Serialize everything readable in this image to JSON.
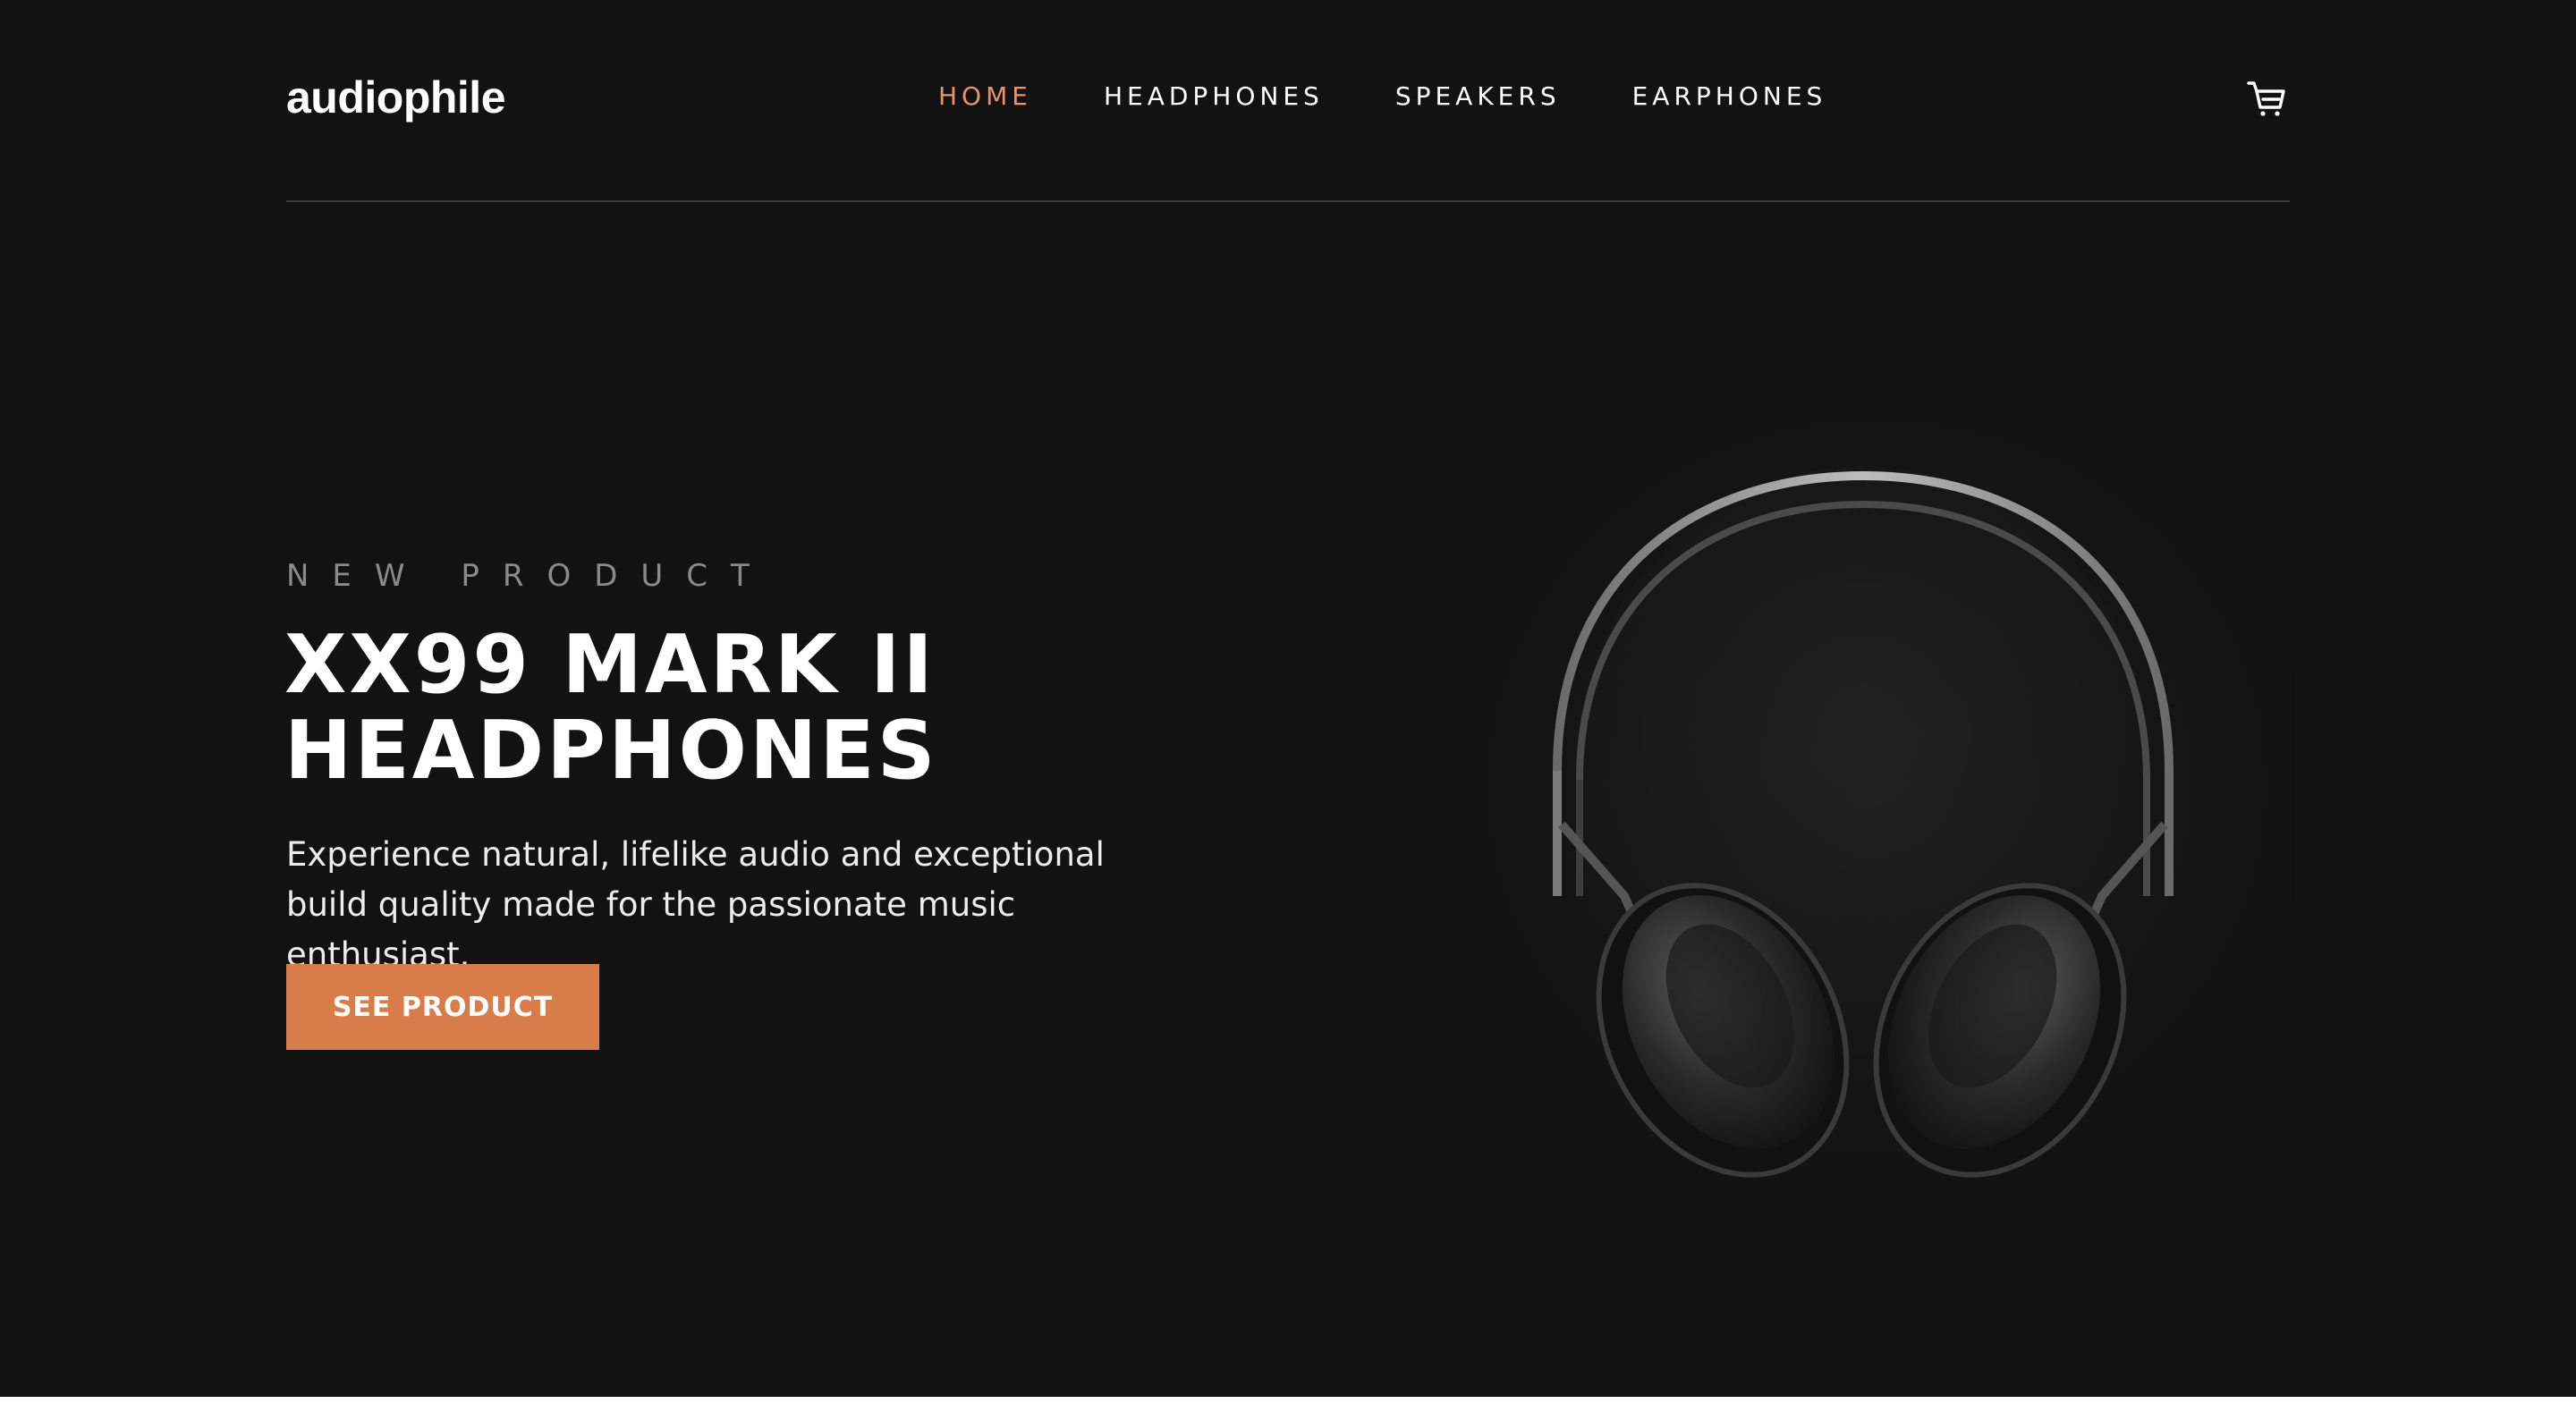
{
  "header": {
    "logo": "audiophile",
    "nav": [
      {
        "label": "HOME",
        "active": true
      },
      {
        "label": "HEADPHONES",
        "active": false
      },
      {
        "label": "SPEAKERS",
        "active": false
      },
      {
        "label": "EARPHONES",
        "active": false
      }
    ],
    "cart_icon": "cart-icon"
  },
  "hero": {
    "overline": "NEW PRODUCT",
    "title_line1": "XX99 MARK II",
    "title_line2": "HEADPHONES",
    "description": "Experience natural, lifelike audio and exceptional build quality made for the passionate music enthusiast.",
    "cta_label": "SEE PRODUCT",
    "image": "headphones-photo"
  },
  "colors": {
    "background": "#121212",
    "accent": "#d87d4a",
    "nav_active": "#e8936a",
    "text": "#ffffff"
  }
}
